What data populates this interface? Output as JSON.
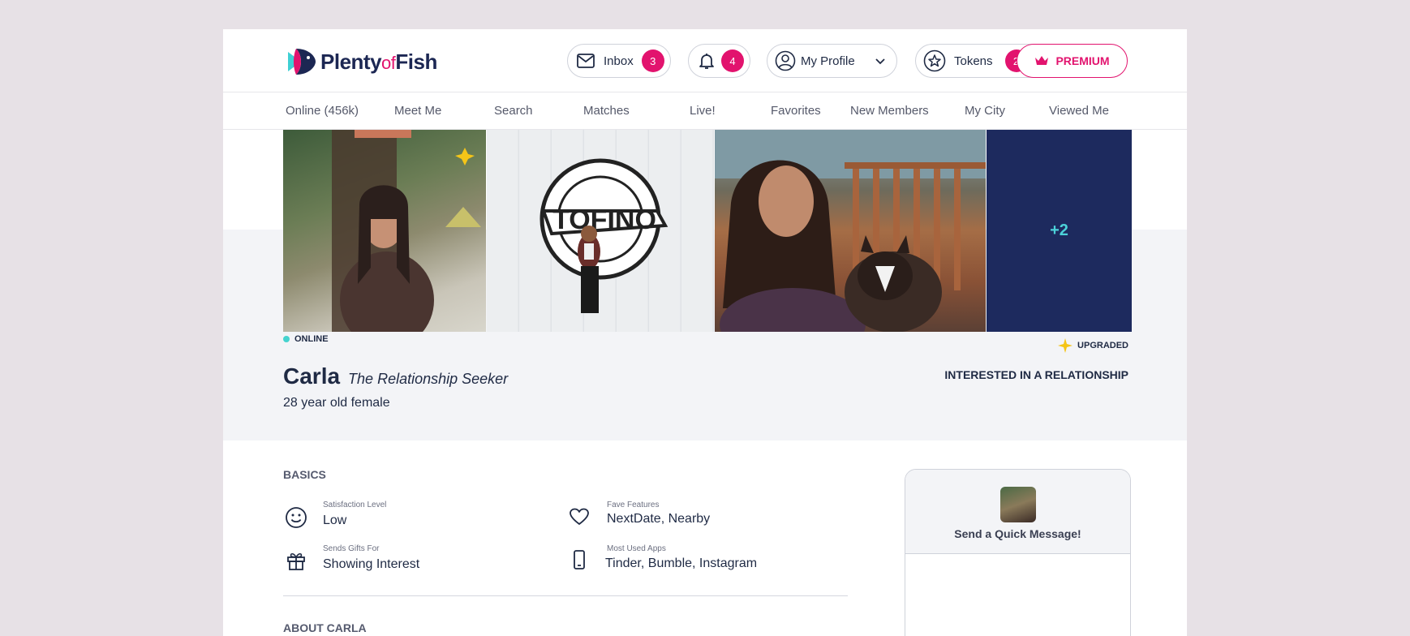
{
  "header": {
    "logo_plenty": "Plenty",
    "logo_of": "of",
    "logo_fish": "Fish",
    "inbox_label": "Inbox",
    "inbox_count": "3",
    "notifications_count": "4",
    "profile_label": "My Profile",
    "tokens_label": "Tokens",
    "tokens_count": "2",
    "premium_label": "PREMIUM"
  },
  "nav": {
    "items": [
      {
        "label": "Online (456k)"
      },
      {
        "label": "Meet Me"
      },
      {
        "label": "Search"
      },
      {
        "label": "Matches"
      },
      {
        "label": "Live!"
      },
      {
        "label": "Favorites"
      },
      {
        "label": "New Members"
      },
      {
        "label": "My City"
      },
      {
        "label": "Viewed Me"
      }
    ]
  },
  "photos": {
    "more_count": "+2"
  },
  "profile": {
    "online_status": "ONLINE",
    "upgraded_label": "UPGRADED",
    "name": "Carla",
    "tagline": "The Relationship Seeker",
    "age_gender": "28 year old female",
    "intent": "INTERESTED IN A RELATIONSHIP"
  },
  "basics": {
    "title": "BASICS",
    "facts": [
      {
        "label": "Satisfaction Level",
        "value": "Low",
        "icon": "smiley-icon"
      },
      {
        "label": "Fave Features",
        "value": "NextDate, Nearby",
        "icon": "heart-icon"
      },
      {
        "label": "Sends Gifts For",
        "value": "Showing Interest",
        "icon": "gift-icon"
      },
      {
        "label": "Most Used Apps",
        "value": "Tinder, Bumble, Instagram",
        "icon": "phone-icon"
      }
    ]
  },
  "about": {
    "title": "ABOUT CARLA"
  },
  "quick_message": {
    "title": "Send a Quick Message!"
  },
  "colors": {
    "brand_pink": "#e2136e",
    "brand_navy": "#1c2753",
    "online_teal": "#45d3cf",
    "upgrade_gold": "#f5c518"
  }
}
